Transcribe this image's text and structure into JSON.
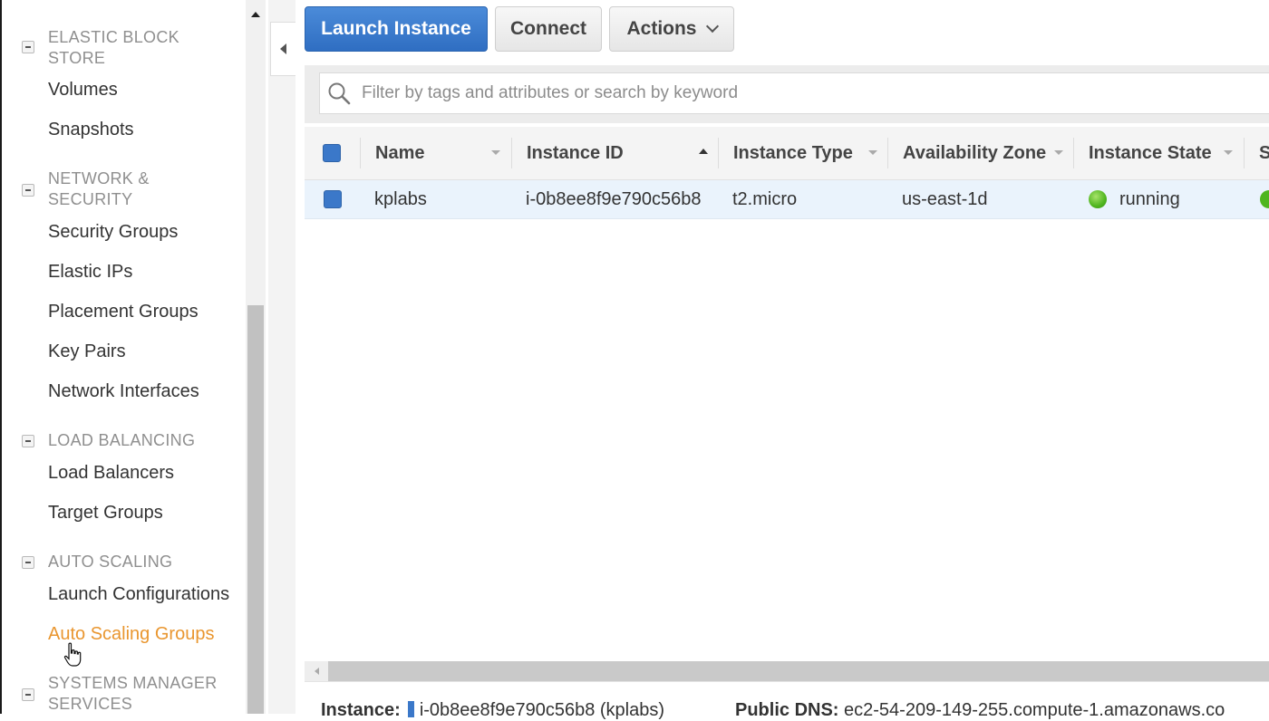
{
  "sidebar": {
    "sections": [
      {
        "title": "ELASTIC BLOCK STORE",
        "items": [
          "Volumes",
          "Snapshots"
        ]
      },
      {
        "title": "NETWORK & SECURITY",
        "items": [
          "Security Groups",
          "Elastic IPs",
          "Placement Groups",
          "Key Pairs",
          "Network Interfaces"
        ]
      },
      {
        "title": "LOAD BALANCING",
        "items": [
          "Load Balancers",
          "Target Groups"
        ]
      },
      {
        "title": "AUTO SCALING",
        "items": [
          "Launch Configurations",
          "Auto Scaling Groups"
        ]
      },
      {
        "title": "SYSTEMS MANAGER SERVICES",
        "items": []
      }
    ],
    "active_item": "Auto Scaling Groups",
    "active_color": "#e9962f"
  },
  "toolbar": {
    "launch_label": "Launch Instance",
    "connect_label": "Connect",
    "actions_label": "Actions"
  },
  "search": {
    "placeholder": "Filter by tags and attributes or search by keyword"
  },
  "table": {
    "columns": [
      "Name",
      "Instance ID",
      "Instance Type",
      "Availability Zone",
      "Instance State",
      "S"
    ],
    "rows": [
      {
        "name": "kplabs",
        "instance_id": "i-0b8ee8f9e790c56b8",
        "instance_type": "t2.micro",
        "availability_zone": "us-east-1d",
        "instance_state": "running"
      }
    ]
  },
  "details": {
    "instance_label": "Instance:",
    "instance_value": "i-0b8ee8f9e790c56b8 (kplabs)",
    "dns_label": "Public DNS:",
    "dns_value": "ec2-54-209-149-255.compute-1.amazonaws.co"
  },
  "colors": {
    "primary": "#2f6ec2",
    "running": "#4fb51f"
  }
}
